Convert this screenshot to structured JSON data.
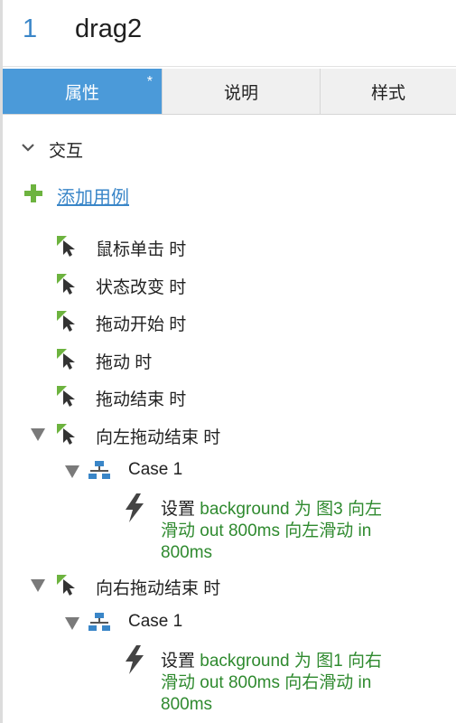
{
  "header": {
    "number": "1",
    "title": "drag2"
  },
  "tabs": [
    {
      "label": "属性",
      "active": true,
      "modified_mark": "*"
    },
    {
      "label": "说明",
      "active": false
    },
    {
      "label": "样式",
      "active": false
    }
  ],
  "section": {
    "label": "交互"
  },
  "add_case": {
    "label": "添加用例"
  },
  "events": [
    {
      "label": "鼠标单击 时"
    },
    {
      "label": "状态改变 时"
    },
    {
      "label": "拖动开始 时"
    },
    {
      "label": "拖动 时"
    },
    {
      "label": "拖动结束 时"
    },
    {
      "label": "向左拖动结束 时",
      "case": {
        "label": "Case 1",
        "action": {
          "verb": "设置",
          "line1": "background 为 图3 向左",
          "line2": "滑动 out 800ms 向左滑动 in",
          "line3": "800ms"
        }
      }
    },
    {
      "label": "向右拖动结束 时",
      "case": {
        "label": "Case 1",
        "action": {
          "verb": "设置",
          "line1": "background 为 图1 向右",
          "line2": "滑动 out 800ms 向右滑动 in",
          "line3": "800ms"
        }
      }
    }
  ],
  "colors": {
    "accent_blue": "#4b9ad9",
    "link_blue": "#3a86c8",
    "action_green": "#2f8a2f",
    "icon_green": "#6db33f"
  },
  "icons": {
    "event": "cursor-event-icon",
    "case": "case-flow-icon",
    "action": "lightning-icon",
    "add": "plus-icon",
    "collapse": "chevron-down-icon"
  }
}
